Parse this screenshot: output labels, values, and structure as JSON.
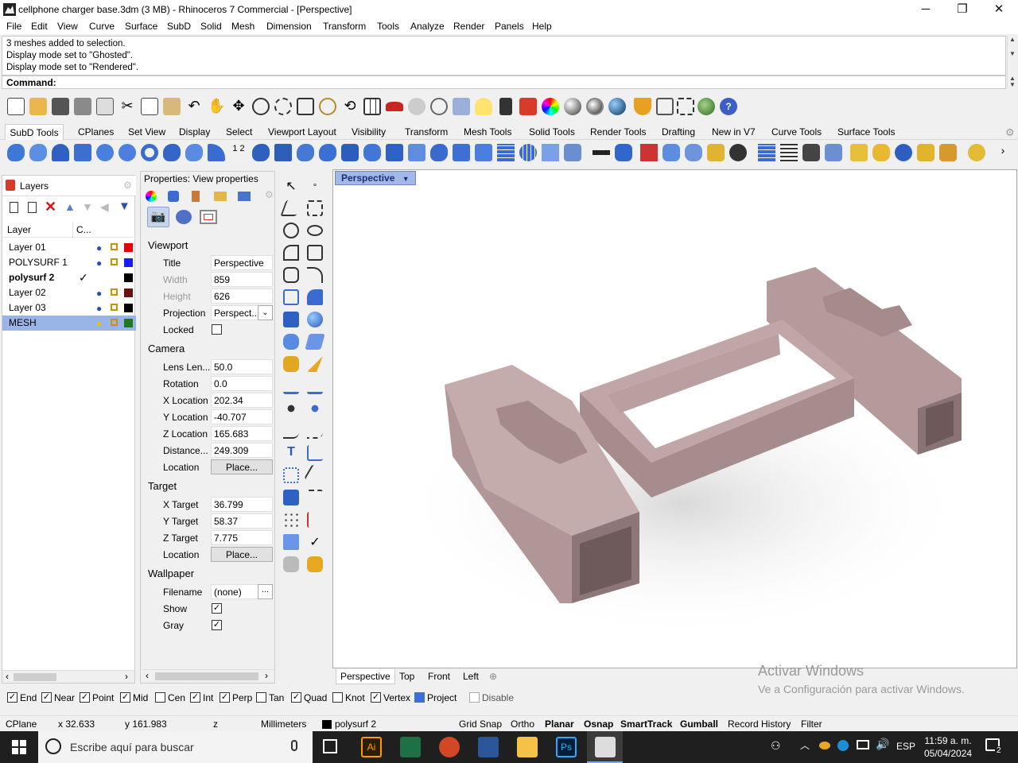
{
  "window": {
    "title": "cellphone charger base.3dm (3 MB) - Rhinoceros 7 Commercial - [Perspective]",
    "minimize": "─",
    "maximize": "❐",
    "close": "✕"
  },
  "menu": [
    "File",
    "Edit",
    "View",
    "Curve",
    "Surface",
    "SubD",
    "Solid",
    "Mesh",
    "Dimension",
    "Transform",
    "Tools",
    "Analyze",
    "Render",
    "Panels",
    "Help"
  ],
  "history": [
    "3 meshes added to selection.",
    "Display mode set to \"Ghosted\".",
    "Display mode set to \"Rendered\"."
  ],
  "command_label": "Command:",
  "toolbar_tabs": [
    "SubD Tools",
    "CPlanes",
    "Set View",
    "Display",
    "Select",
    "Viewport Layout",
    "Visibility",
    "Transform",
    "Mesh Tools",
    "Solid Tools",
    "Render Tools",
    "Drafting",
    "New in V7",
    "Curve Tools",
    "Surface Tools"
  ],
  "layers": {
    "tab_label": "Layers",
    "col_layer": "Layer",
    "col_c": "C...",
    "rows": [
      {
        "name": "Layer 01",
        "color": "#e00000"
      },
      {
        "name": "POLYSURF 1",
        "color": "#1a1aff"
      },
      {
        "name": "polysurf 2",
        "color": "#000000",
        "current": "✓"
      },
      {
        "name": "Layer 02",
        "color": "#6b1111"
      },
      {
        "name": "Layer 03",
        "color": "#000000"
      },
      {
        "name": "MESH",
        "color": "#1d7a1d"
      }
    ]
  },
  "properties": {
    "header": "Properties: View properties",
    "viewport_section": "Viewport",
    "camera_section": "Camera",
    "target_section": "Target",
    "wallpaper_section": "Wallpaper",
    "title_label": "Title",
    "title": "Perspective",
    "width_label": "Width",
    "width": "859",
    "height_label": "Height",
    "height": "626",
    "projection_label": "Projection",
    "projection": "Perspect...",
    "locked_label": "Locked",
    "lens_label": "Lens Len...",
    "lens": "50.0",
    "rotation_label": "Rotation",
    "rotation": "0.0",
    "xloc_label": "X Location",
    "xloc": "202.34",
    "yloc_label": "Y Location",
    "yloc": "-40.707",
    "zloc_label": "Z Location",
    "zloc": "165.683",
    "dist_label": "Distance...",
    "dist": "249.309",
    "loc_label": "Location",
    "place": "Place...",
    "xt_label": "X Target",
    "xt": "36.799",
    "yt_label": "Y Target",
    "yt": "58.37",
    "zt_label": "Z Target",
    "zt": "7.775",
    "tloc_label": "Location",
    "filename_label": "Filename",
    "filename": "(none)",
    "browse": "...",
    "show_label": "Show",
    "gray_label": "Gray"
  },
  "viewport": {
    "active_tab": "Perspective",
    "tabs": [
      "Perspective",
      "Top",
      "Front",
      "Left"
    ],
    "add_tab": "⊕"
  },
  "osnap": [
    "End",
    "Near",
    "Point",
    "Mid",
    "Cen",
    "Int",
    "Perp",
    "Tan",
    "Quad",
    "Knot",
    "Vertex"
  ],
  "osnap_checked": [
    true,
    true,
    true,
    true,
    false,
    true,
    true,
    false,
    true,
    false,
    true
  ],
  "osnap_project": "Project",
  "osnap_disable": "Disable",
  "watermark": {
    "line1": "Activar Windows",
    "line2": "Ve a Configuración para activar Windows."
  },
  "status": {
    "cplane": "CPlane",
    "x": "x 32.633",
    "y": "y 161.983",
    "z": "z",
    "units": "Millimeters",
    "layer": "polysurf 2",
    "grid_snap": "Grid Snap",
    "ortho": "Ortho",
    "planar": "Planar",
    "osnap": "Osnap",
    "smarttrack": "SmartTrack",
    "gumball": "Gumball",
    "record_history": "Record History",
    "filter": "Filter"
  },
  "taskbar": {
    "search": "Escribe aquí para buscar",
    "lang": "ESP",
    "time": "11:59 a. m.",
    "date": "05/04/2024",
    "notif": "2"
  },
  "colors": {
    "model": "#b49a9b",
    "accent": "#0078d7"
  }
}
